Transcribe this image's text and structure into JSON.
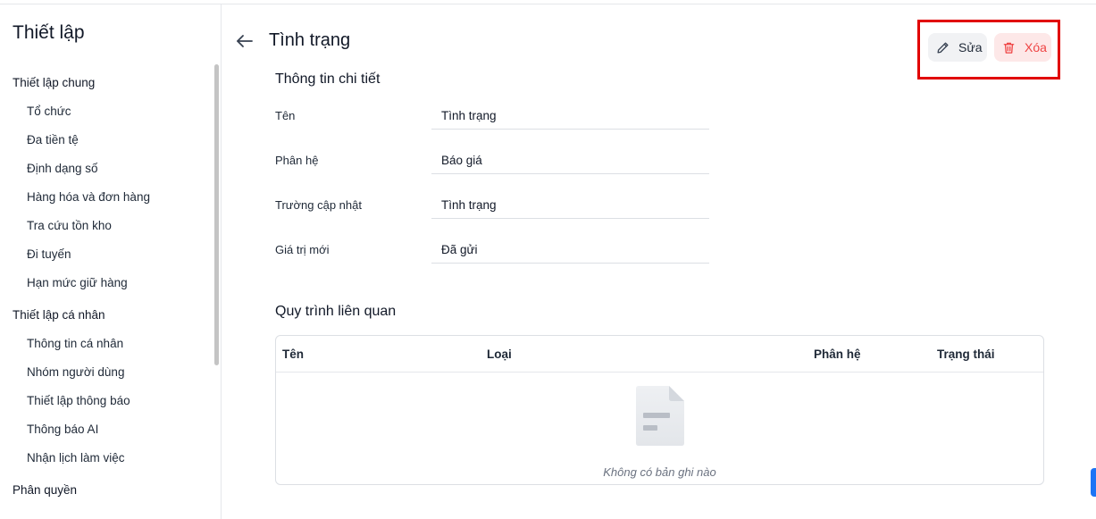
{
  "sidebar": {
    "title": "Thiết lập",
    "groups": [
      {
        "label": "Thiết lập chung",
        "items": [
          "Tổ chức",
          "Đa tiền tệ",
          "Định dạng số",
          "Hàng hóa và đơn hàng",
          "Tra cứu tồn kho",
          "Đi tuyến",
          "Hạn mức giữ hàng"
        ]
      },
      {
        "label": "Thiết lập cá nhân",
        "items": [
          "Thông tin cá nhân",
          "Nhóm người dùng",
          "Thiết lập thông báo",
          "Thông báo AI",
          "Nhận lịch làm việc"
        ]
      },
      {
        "label": "Phân quyền",
        "items": []
      }
    ]
  },
  "header": {
    "title": "Tình trạng",
    "edit_label": "Sửa",
    "delete_label": "Xóa"
  },
  "details": {
    "title": "Thông tin chi tiết",
    "rows": [
      {
        "label": "Tên",
        "value": "Tình trạng"
      },
      {
        "label": "Phân hệ",
        "value": "Báo giá"
      },
      {
        "label": "Trường cập nhật",
        "value": "Tình trạng"
      },
      {
        "label": "Giá trị mới",
        "value": "Đã gửi"
      }
    ]
  },
  "related": {
    "title": "Quy trình liên quan",
    "columns": [
      "Tên",
      "Loại",
      "Phân hệ",
      "Trạng thái"
    ],
    "empty_text": "Không có bản ghi nào"
  },
  "colors": {
    "accent": "#1d74f5",
    "danger": "#ef4444",
    "highlight": "#e10000"
  }
}
